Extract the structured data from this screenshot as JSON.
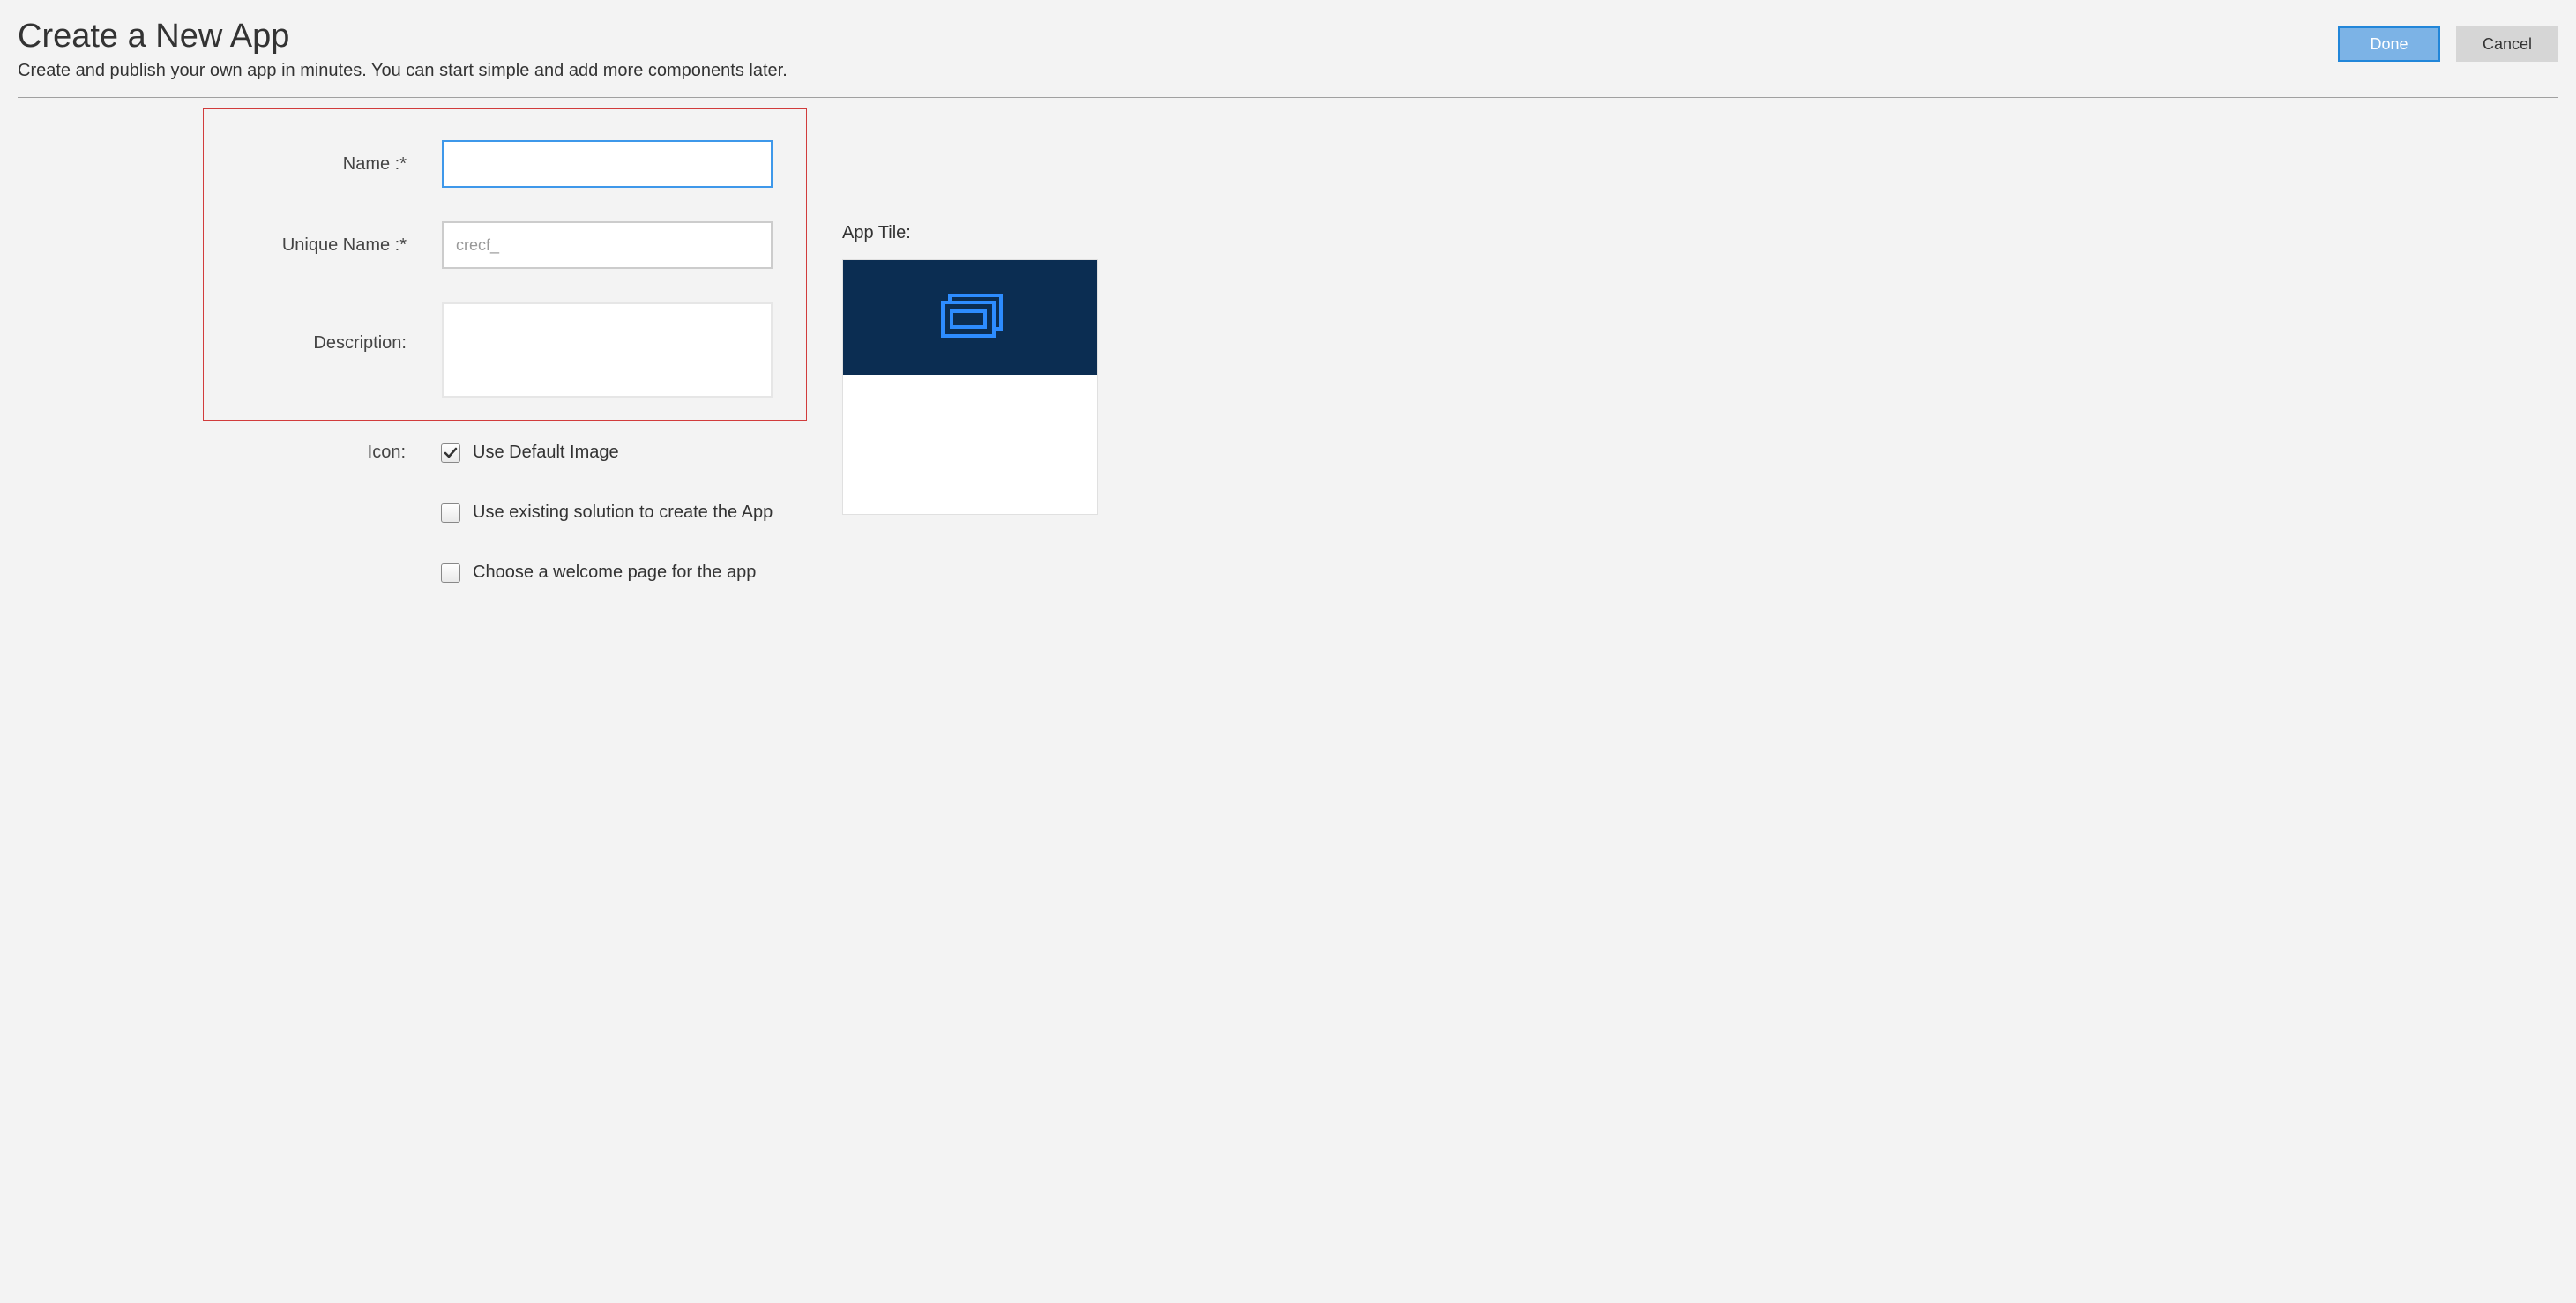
{
  "header": {
    "title": "Create a New App",
    "subtitle": "Create and publish your own app in minutes. You can start simple and add more components later.",
    "done_label": "Done",
    "cancel_label": "Cancel"
  },
  "form": {
    "name_label": "Name :*",
    "name_value": "",
    "unique_name_label": "Unique Name :*",
    "unique_name_value": "crecf_",
    "description_label": "Description:",
    "description_value": "",
    "icon_label": "Icon:",
    "use_default_image_label": "Use Default Image",
    "use_default_image_checked": true,
    "use_existing_solution_label": "Use existing solution to create the App",
    "use_existing_solution_checked": false,
    "choose_welcome_label": "Choose a welcome page for the app",
    "choose_welcome_checked": false
  },
  "tile": {
    "label": "App Tile:",
    "header_color": "#0b2d52",
    "icon_color": "#2d8cff"
  }
}
